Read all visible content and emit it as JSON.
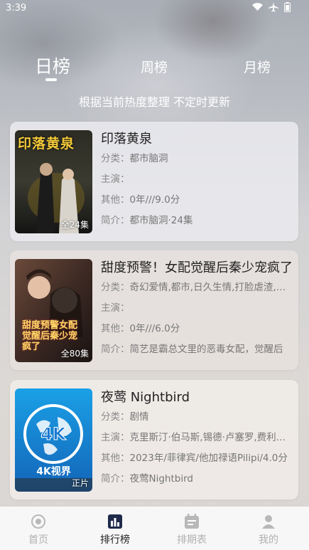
{
  "status": {
    "time": "3:39"
  },
  "tabs": [
    {
      "label": "日榜",
      "active": true
    },
    {
      "label": "周榜",
      "active": false
    },
    {
      "label": "月榜",
      "active": false
    }
  ],
  "subtitle": "根据当前热度整理 不定时更新",
  "cards": [
    {
      "title": "印落黄泉",
      "poster_title": "印落黄泉",
      "episodes": "全24集",
      "category_label": "分类：",
      "category": "都市脑洞",
      "cast_label": "主演：",
      "cast": "",
      "other_label": "其他：",
      "other": "0年///9.0分",
      "intro_label": "简介：",
      "intro": "都市脑洞·24集"
    },
    {
      "title": "甜度预警！女配觉醒后秦少宠疯了",
      "poster_title": "甜度预警女配觉醒后秦少宠疯了",
      "episodes": "全80集",
      "category_label": "分类：",
      "category": "奇幻爱情,都市,日久生情,打脸虐渣,逆袭",
      "cast_label": "主演：",
      "cast": "",
      "other_label": "其他：",
      "other": "0年///6.0分",
      "intro_label": "简介：",
      "intro": "简艺是霸总文里的恶毒女配，觉醒后"
    },
    {
      "title": "夜莺 Nightbird",
      "poster_title": "4K视界",
      "episodes": "正片",
      "category_label": "分类：",
      "category": "剧情",
      "cast_label": "主演：",
      "cast": "克里斯汀·伯马斯,锡德·卢塞罗,费利克斯",
      "other_label": "其他：",
      "other": "2023年/菲律宾/他加禄语Pilipi/4.0分",
      "intro_label": "简介：",
      "intro": "夜莺Nightbird"
    }
  ],
  "nav": [
    {
      "label": "首页",
      "icon": "home-icon",
      "active": false
    },
    {
      "label": "排行榜",
      "icon": "ranking-icon",
      "active": true
    },
    {
      "label": "排期表",
      "icon": "calendar-icon",
      "active": false
    },
    {
      "label": "我的",
      "icon": "profile-icon",
      "active": false
    }
  ],
  "colors": {
    "accent": "#1f2a4a",
    "text": "#222222",
    "muted": "#777777"
  }
}
